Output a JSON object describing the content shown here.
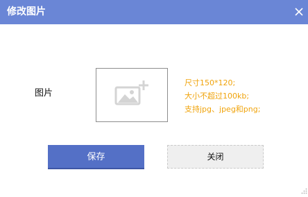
{
  "dialog": {
    "title": "修改图片",
    "close_icon": "close-icon"
  },
  "form": {
    "image_label": "图片",
    "upload_icon": "image-add-icon",
    "hints": [
      "尺寸150*120;",
      "大小不超过100kb;",
      "支持jpg、jpeg和png;"
    ]
  },
  "buttons": {
    "save_label": "保存",
    "close_label": "关闭"
  },
  "colors": {
    "title_bar": "#6a86d6",
    "primary_button": "#5470c6",
    "hint_text": "#f0a30a",
    "secondary_button": "#efefef"
  }
}
